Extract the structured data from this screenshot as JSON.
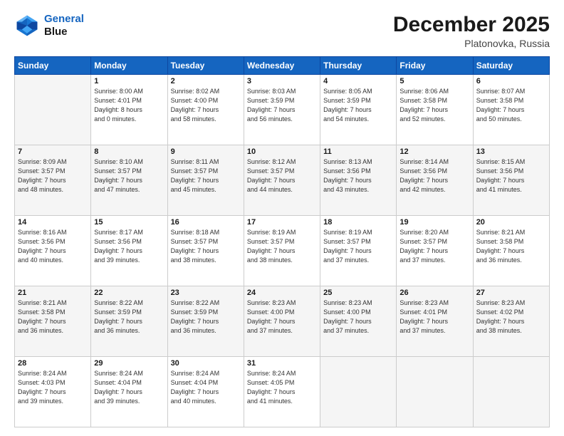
{
  "header": {
    "logo_line1": "General",
    "logo_line2": "Blue",
    "title": "December 2025",
    "subtitle": "Platonovka, Russia"
  },
  "calendar": {
    "days": [
      "Sunday",
      "Monday",
      "Tuesday",
      "Wednesday",
      "Thursday",
      "Friday",
      "Saturday"
    ],
    "weeks": [
      [
        {
          "num": "",
          "info": ""
        },
        {
          "num": "1",
          "info": "Sunrise: 8:00 AM\nSunset: 4:01 PM\nDaylight: 8 hours\nand 0 minutes."
        },
        {
          "num": "2",
          "info": "Sunrise: 8:02 AM\nSunset: 4:00 PM\nDaylight: 7 hours\nand 58 minutes."
        },
        {
          "num": "3",
          "info": "Sunrise: 8:03 AM\nSunset: 3:59 PM\nDaylight: 7 hours\nand 56 minutes."
        },
        {
          "num": "4",
          "info": "Sunrise: 8:05 AM\nSunset: 3:59 PM\nDaylight: 7 hours\nand 54 minutes."
        },
        {
          "num": "5",
          "info": "Sunrise: 8:06 AM\nSunset: 3:58 PM\nDaylight: 7 hours\nand 52 minutes."
        },
        {
          "num": "6",
          "info": "Sunrise: 8:07 AM\nSunset: 3:58 PM\nDaylight: 7 hours\nand 50 minutes."
        }
      ],
      [
        {
          "num": "7",
          "info": "Sunrise: 8:09 AM\nSunset: 3:57 PM\nDaylight: 7 hours\nand 48 minutes."
        },
        {
          "num": "8",
          "info": "Sunrise: 8:10 AM\nSunset: 3:57 PM\nDaylight: 7 hours\nand 47 minutes."
        },
        {
          "num": "9",
          "info": "Sunrise: 8:11 AM\nSunset: 3:57 PM\nDaylight: 7 hours\nand 45 minutes."
        },
        {
          "num": "10",
          "info": "Sunrise: 8:12 AM\nSunset: 3:57 PM\nDaylight: 7 hours\nand 44 minutes."
        },
        {
          "num": "11",
          "info": "Sunrise: 8:13 AM\nSunset: 3:56 PM\nDaylight: 7 hours\nand 43 minutes."
        },
        {
          "num": "12",
          "info": "Sunrise: 8:14 AM\nSunset: 3:56 PM\nDaylight: 7 hours\nand 42 minutes."
        },
        {
          "num": "13",
          "info": "Sunrise: 8:15 AM\nSunset: 3:56 PM\nDaylight: 7 hours\nand 41 minutes."
        }
      ],
      [
        {
          "num": "14",
          "info": "Sunrise: 8:16 AM\nSunset: 3:56 PM\nDaylight: 7 hours\nand 40 minutes."
        },
        {
          "num": "15",
          "info": "Sunrise: 8:17 AM\nSunset: 3:56 PM\nDaylight: 7 hours\nand 39 minutes."
        },
        {
          "num": "16",
          "info": "Sunrise: 8:18 AM\nSunset: 3:57 PM\nDaylight: 7 hours\nand 38 minutes."
        },
        {
          "num": "17",
          "info": "Sunrise: 8:19 AM\nSunset: 3:57 PM\nDaylight: 7 hours\nand 38 minutes."
        },
        {
          "num": "18",
          "info": "Sunrise: 8:19 AM\nSunset: 3:57 PM\nDaylight: 7 hours\nand 37 minutes."
        },
        {
          "num": "19",
          "info": "Sunrise: 8:20 AM\nSunset: 3:57 PM\nDaylight: 7 hours\nand 37 minutes."
        },
        {
          "num": "20",
          "info": "Sunrise: 8:21 AM\nSunset: 3:58 PM\nDaylight: 7 hours\nand 36 minutes."
        }
      ],
      [
        {
          "num": "21",
          "info": "Sunrise: 8:21 AM\nSunset: 3:58 PM\nDaylight: 7 hours\nand 36 minutes."
        },
        {
          "num": "22",
          "info": "Sunrise: 8:22 AM\nSunset: 3:59 PM\nDaylight: 7 hours\nand 36 minutes."
        },
        {
          "num": "23",
          "info": "Sunrise: 8:22 AM\nSunset: 3:59 PM\nDaylight: 7 hours\nand 36 minutes."
        },
        {
          "num": "24",
          "info": "Sunrise: 8:23 AM\nSunset: 4:00 PM\nDaylight: 7 hours\nand 37 minutes."
        },
        {
          "num": "25",
          "info": "Sunrise: 8:23 AM\nSunset: 4:00 PM\nDaylight: 7 hours\nand 37 minutes."
        },
        {
          "num": "26",
          "info": "Sunrise: 8:23 AM\nSunset: 4:01 PM\nDaylight: 7 hours\nand 37 minutes."
        },
        {
          "num": "27",
          "info": "Sunrise: 8:23 AM\nSunset: 4:02 PM\nDaylight: 7 hours\nand 38 minutes."
        }
      ],
      [
        {
          "num": "28",
          "info": "Sunrise: 8:24 AM\nSunset: 4:03 PM\nDaylight: 7 hours\nand 39 minutes."
        },
        {
          "num": "29",
          "info": "Sunrise: 8:24 AM\nSunset: 4:04 PM\nDaylight: 7 hours\nand 39 minutes."
        },
        {
          "num": "30",
          "info": "Sunrise: 8:24 AM\nSunset: 4:04 PM\nDaylight: 7 hours\nand 40 minutes."
        },
        {
          "num": "31",
          "info": "Sunrise: 8:24 AM\nSunset: 4:05 PM\nDaylight: 7 hours\nand 41 minutes."
        },
        {
          "num": "",
          "info": ""
        },
        {
          "num": "",
          "info": ""
        },
        {
          "num": "",
          "info": ""
        }
      ]
    ]
  }
}
